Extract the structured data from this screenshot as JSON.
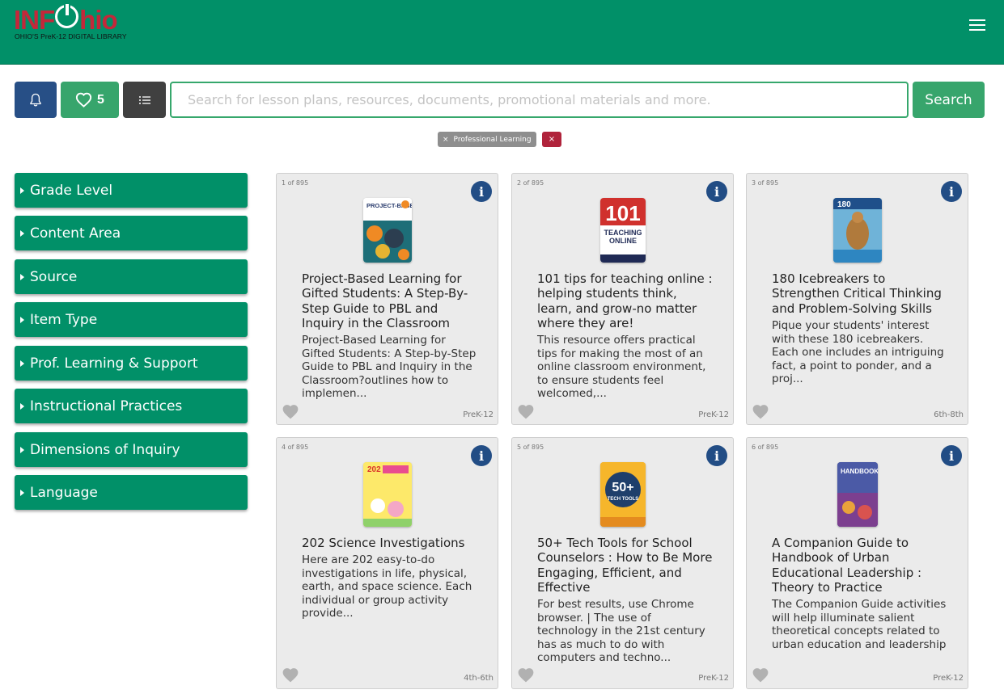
{
  "header": {
    "logo_text_left": "INF",
    "logo_text_right": "hio",
    "logo_tagline": "OHIO'S PreK-12 DIGITAL LIBRARY",
    "menu_icon": "hamburger-menu-icon"
  },
  "toolbar": {
    "bell_icon": "bell-icon",
    "favorites_count": "5",
    "list_icon": "list-icon",
    "search_placeholder": "Search for lesson plans, resources, documents, promotional materials and more.",
    "search_value": "",
    "search_button": "Search"
  },
  "active_filters": {
    "chip_label": "Professional Learning",
    "chip_remove": "×",
    "clear_all": "×"
  },
  "sidebar": {
    "facets": [
      {
        "label": "Grade Level"
      },
      {
        "label": "Content Area"
      },
      {
        "label": "Source"
      },
      {
        "label": "Item Type"
      },
      {
        "label": "Prof. Learning & Support"
      },
      {
        "label": "Instructional Practices"
      },
      {
        "label": "Dimensions of Inquiry"
      },
      {
        "label": "Language"
      }
    ]
  },
  "results": {
    "cards": [
      {
        "count": "1 of 895",
        "title": "Project-Based Learning for Gifted Students: A Step-By-Step Guide to PBL and Inquiry in the Classroom",
        "description": "Project-Based Learning for Gifted Students: A Step-by-Step Guide to PBL and Inquiry in the Classroom?outlines how to implemen...",
        "grade": "PreK-12",
        "cover_text": "PROJECT-BASED LEARNING"
      },
      {
        "count": "2 of 895",
        "title": "101 tips for teaching online : helping students think, learn, and grow-no matter where they are!",
        "description": "This resource offers practical tips for making the most of an online classroom environment, to ensure students feel welcomed,...",
        "grade": "PreK-12",
        "cover_text": "101"
      },
      {
        "count": "3 of 895",
        "title": "180 Icebreakers to Strengthen Critical Thinking and Problem-Solving Skills",
        "description": "Pique your students' interest with these 180 icebreakers. Each one includes an intriguing fact, a point to ponder, and a proj...",
        "grade": "6th-8th",
        "cover_text": "180"
      },
      {
        "count": "4 of 895",
        "title": "202 Science Investigations",
        "description": "Here are 202 easy-to-do investigations in life, physical, earth, and space science. Each individual or group activity provide...",
        "grade": "4th-6th",
        "cover_text": "202"
      },
      {
        "count": "5 of 895",
        "title": "50+ Tech Tools for School Counselors : How to Be More Engaging, Efficient, and Effective",
        "description": "For best results, use Chrome browser. | The use of technology in the 21st century has as much to do with computers and techno...",
        "grade": "PreK-12",
        "cover_text": "50+"
      },
      {
        "count": "6 of 895",
        "title": "A Companion Guide to Handbook of Urban Educational Leadership : Theory to Practice",
        "description": "The Companion Guide activities will help illuminate salient theoretical concepts related to urban education and leadership",
        "grade": "PreK-12",
        "cover_text": "HANDBOOK"
      }
    ]
  },
  "colors": {
    "header_green": "#019068",
    "accent_green": "#37a56c",
    "navy": "#274f86",
    "info_blue": "#224d85",
    "dark_gray": "#404040",
    "logo_red": "#c3283a",
    "clear_red": "#b0233b"
  }
}
